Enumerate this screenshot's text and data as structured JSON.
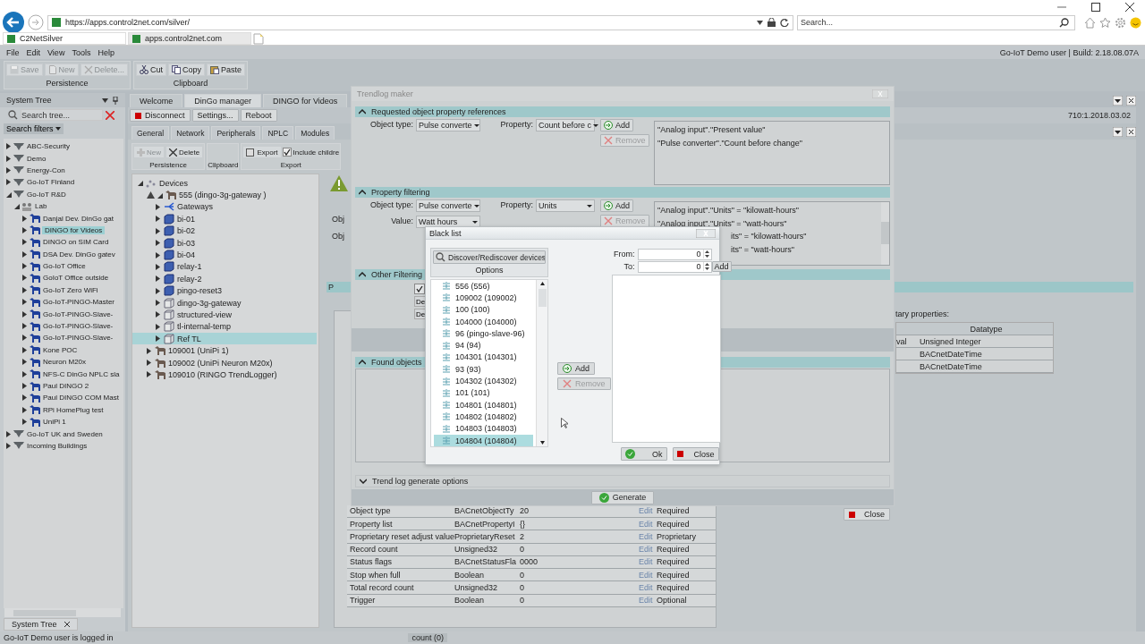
{
  "browser": {
    "address": "https://apps.control2net.com/silver/",
    "search": {
      "placeholder": "Search..."
    },
    "tabs": [
      {
        "label": "C2NetSilver",
        "selected": true
      },
      {
        "label": "apps.control2net.com",
        "selected": false
      }
    ]
  },
  "menu": [
    "File",
    "Edit",
    "View",
    "Tools",
    "Help"
  ],
  "user_info": "Go-IoT Demo user  | Build: 2.18.08.07A",
  "toolbar_groups": [
    {
      "label": "Persistence",
      "buttons": [
        {
          "label": "Save",
          "kind": "save",
          "disabled": true
        },
        {
          "label": "New",
          "kind": "new",
          "disabled": true
        },
        {
          "label": "Delete...",
          "kind": "delete",
          "disabled": true
        }
      ]
    },
    {
      "label": "Clipboard",
      "buttons": [
        {
          "label": "Cut",
          "kind": "cut",
          "disabled": false
        },
        {
          "label": "Copy",
          "kind": "copy",
          "disabled": false
        },
        {
          "label": "Paste",
          "kind": "paste",
          "disabled": false
        }
      ]
    }
  ],
  "system_tree": {
    "title": "System Tree",
    "search": {
      "placeholder": "Search tree..."
    },
    "filters": "Search filters",
    "bottom_tab": "System Tree",
    "items": [
      {
        "label": "ABC-Security",
        "kind": "site",
        "expanded": false,
        "selected": false
      },
      {
        "label": "Demo",
        "kind": "site",
        "expanded": false,
        "selected": false
      },
      {
        "label": "Energy-Con",
        "kind": "site",
        "expanded": false,
        "selected": false
      },
      {
        "label": "Go-IoT Finland",
        "kind": "site",
        "expanded": false,
        "selected": false
      },
      {
        "label": "Go-IoT R&D",
        "kind": "site",
        "expanded": true,
        "selected": false,
        "children": [
          {
            "label": "Lab",
            "kind": "group",
            "expanded": true,
            "selected": false,
            "children": [
              {
                "label": "Danjal Dev. DinGo gat",
                "kind": "device",
                "expanded": false,
                "selected": false
              },
              {
                "label": "DINGO for Videos",
                "kind": "device",
                "expanded": false,
                "selected": true
              },
              {
                "label": "DINGO on SIM Card",
                "kind": "device",
                "expanded": false,
                "selected": false
              },
              {
                "label": "DSA Dev. DinGo gatev",
                "kind": "device",
                "expanded": false,
                "selected": false
              },
              {
                "label": "Go-IoT Office",
                "kind": "device",
                "expanded": false,
                "selected": false
              },
              {
                "label": "GoIoT Office outside",
                "kind": "device",
                "expanded": false,
                "selected": false
              },
              {
                "label": "Go-IoT Zero WiFi",
                "kind": "device",
                "expanded": false,
                "selected": false
              },
              {
                "label": "Go-IoT-PINGO-Master",
                "kind": "device",
                "expanded": false,
                "selected": false
              },
              {
                "label": "Go-IoT-PINGO-Slave-",
                "kind": "device",
                "expanded": false,
                "selected": false
              },
              {
                "label": "Go-IoT-PINGO-Slave-",
                "kind": "device",
                "expanded": false,
                "selected": false
              },
              {
                "label": "Go-IoT-PINGO-Slave-",
                "kind": "device",
                "expanded": false,
                "selected": false
              },
              {
                "label": "Kone POC",
                "kind": "device",
                "expanded": false,
                "selected": false
              },
              {
                "label": "Neuron M20x",
                "kind": "device",
                "expanded": false,
                "selected": false
              },
              {
                "label": "NFS-C DinGo NPLC sla",
                "kind": "device",
                "expanded": false,
                "selected": false
              },
              {
                "label": "Paul DINGO 2",
                "kind": "device",
                "expanded": false,
                "selected": false
              },
              {
                "label": "Paul DINGO COM Mast",
                "kind": "device",
                "expanded": false,
                "selected": false
              },
              {
                "label": "RPi HomePlug test",
                "kind": "device",
                "expanded": false,
                "selected": false
              },
              {
                "label": "UniPi 1",
                "kind": "device",
                "expanded": false,
                "selected": false
              }
            ]
          }
        ]
      },
      {
        "label": "Go-IoT UK and Sweden",
        "kind": "site",
        "expanded": false,
        "selected": false
      },
      {
        "label": "Incoming Buildings",
        "kind": "site",
        "expanded": false,
        "selected": false
      }
    ]
  },
  "document_tabs": [
    {
      "label": "Welcome",
      "selected": false
    },
    {
      "label": "DinGo manager",
      "selected": true
    },
    {
      "label": "DINGO for Videos",
      "selected": false
    }
  ],
  "device_toolbar": [
    {
      "label": "Disconnect",
      "kind": "stop"
    },
    {
      "label": "Settings...",
      "kind": "plain"
    },
    {
      "label": "Reboot",
      "kind": "plain"
    }
  ],
  "version": "710:1.2018.03.02",
  "sub_tabs": [
    "General",
    "Network",
    "Peripherals",
    "NPLC",
    "Modules"
  ],
  "module_toolbar": {
    "groups": [
      "Persistence",
      "Clipboard",
      "Export"
    ],
    "new": {
      "label": "New",
      "disabled": true
    },
    "delete": {
      "label": "Delete",
      "disabled": false
    },
    "export": "Export",
    "include": {
      "label": "Include childre",
      "checked": true
    }
  },
  "devices": [
    {
      "label": "Devices",
      "kind": "devices",
      "expanded": true,
      "selected": false,
      "children": [
        {
          "label": "555 (dingo-3g-gateway )",
          "kind": "device",
          "warning": true,
          "expanded": true,
          "selected": false,
          "children": [
            {
              "label": "Gateways",
              "kind": "gateways",
              "expanded": false,
              "selected": false
            },
            {
              "label": "bi-01",
              "kind": "object",
              "expanded": false,
              "selected": false
            },
            {
              "label": "bi-02",
              "kind": "object",
              "expanded": false,
              "selected": false
            },
            {
              "label": "bi-03",
              "kind": "object",
              "expanded": false,
              "selected": false
            },
            {
              "label": "bi-04",
              "kind": "object",
              "expanded": false,
              "selected": false
            },
            {
              "label": "relay-1",
              "kind": "object",
              "expanded": false,
              "selected": false
            },
            {
              "label": "relay-2",
              "kind": "object",
              "expanded": false,
              "selected": false
            },
            {
              "label": "pingo-reset3",
              "kind": "object",
              "expanded": false,
              "selected": false
            },
            {
              "label": "dingo-3g-gateway",
              "kind": "outline",
              "expanded": false,
              "selected": false
            },
            {
              "label": "structured-view",
              "kind": "outline",
              "expanded": false,
              "selected": false
            },
            {
              "label": "tl-internal-temp",
              "kind": "outline",
              "expanded": false,
              "selected": false
            },
            {
              "label": "Ref TL",
              "kind": "outline",
              "expanded": false,
              "selected": true
            }
          ]
        },
        {
          "label": "109001 (UniPi 1)",
          "kind": "device",
          "expanded": false,
          "selected": false
        },
        {
          "label": "109002 (UniPi Neuron M20x)",
          "kind": "device",
          "expanded": false,
          "selected": false
        },
        {
          "label": "109010 (RINGO TrendLogger)",
          "kind": "device",
          "expanded": false,
          "selected": false
        }
      ]
    }
  ],
  "module_panel": {
    "obj_labels": [
      "Obj",
      "Obj"
    ],
    "section_fragment": "P",
    "properties_label": "tary properties:",
    "properties_table": {
      "columns": [
        "Datatype"
      ],
      "rows": [
        {
          "column_1": "val",
          "datatype": "Unsigned Integer"
        },
        {
          "datatype": "BACnetDateTime"
        },
        {
          "datatype": "BACnetDateTime"
        }
      ]
    },
    "object_table": [
      {
        "name": "Object type",
        "type": "BACnetObjectTy",
        "value": "20",
        "edit": "Edit",
        "status": "Required"
      },
      {
        "name": "Property list",
        "type": "BACnetPropertyI",
        "value": "{}",
        "edit": "Edit",
        "status": "Required"
      },
      {
        "name": "Proprietary reset adjust value",
        "type": "ProprietaryReset",
        "value": "2",
        "edit": "Edit",
        "status": "Proprietary"
      },
      {
        "name": "Record count",
        "type": "Unsigned32",
        "value": "0",
        "edit": "Edit",
        "status": "Required"
      },
      {
        "name": "Status flags",
        "type": "BACnetStatusFla",
        "value": "0000",
        "edit": "Edit",
        "status": "Required"
      },
      {
        "name": "Stop when full",
        "type": "Boolean",
        "value": "0",
        "edit": "Edit",
        "status": "Required"
      },
      {
        "name": "Total record count",
        "type": "Unsigned32",
        "value": "0",
        "edit": "Edit",
        "status": "Required"
      },
      {
        "name": "Trigger",
        "type": "Boolean",
        "value": "0",
        "edit": "Edit",
        "status": "Optional"
      }
    ]
  },
  "status_bar": {
    "message": "Go-IoT Demo user is logged in",
    "count": "count (0)"
  },
  "trendlog_dialog": {
    "title": "Trendlog maker",
    "requested": {
      "title": "Requested object property references",
      "expanded": true,
      "object_type": {
        "label": "Object type:",
        "value": "Pulse converte"
      },
      "property": {
        "label": "Property:",
        "value": "Count before c"
      },
      "add": "Add",
      "remove": {
        "label": "Remove",
        "disabled": true
      },
      "list": [
        {
          "text": "\"Analog input\".\"Present value\"",
          "cut": false
        },
        {
          "text": "\"Pulse converter\".\"Count before change\"",
          "cut": false
        }
      ]
    },
    "filtering": {
      "title": "Property filtering",
      "expanded": true,
      "object_type": {
        "label": "Object type:",
        "value": "Pulse converte"
      },
      "property": {
        "label": "Property:",
        "value": "Units"
      },
      "value": {
        "label": "Value:",
        "value": "Watt hours"
      },
      "add": "Add",
      "remove": {
        "label": "Remove",
        "disabled": true
      },
      "list": [
        {
          "text": "\"Analog input\".\"Units\" = \"kilowatt-hours\"",
          "cut": false
        },
        {
          "text": "\"Analog input\".\"Units\" = \"watt-hours\"",
          "cut": false
        },
        {
          "text": "its\" = \"kilowatt-hours\"",
          "cut": true
        },
        {
          "text": "its\" = \"watt-hours\"",
          "cut": true
        }
      ]
    },
    "other": {
      "title": "Other Filtering",
      "expanded": true,
      "checked": true,
      "buttons": [
        "De",
        "De"
      ]
    },
    "found": {
      "title": "Found objects",
      "expanded": true
    },
    "options": {
      "title": "Trend log generate options",
      "expanded": false
    },
    "generate": "Generate",
    "close": "Close"
  },
  "blacklist_dialog": {
    "title": "Black list",
    "discover": "Discover/Rediscover devices",
    "options": "Options",
    "devices": [
      {
        "label": "556 (556)",
        "selected": false
      },
      {
        "label": "109002 (109002)",
        "selected": false
      },
      {
        "label": "100 (100)",
        "selected": false
      },
      {
        "label": "104000 (104000)",
        "selected": false
      },
      {
        "label": "96 (pingo-slave-96)",
        "selected": false
      },
      {
        "label": "94 (94)",
        "selected": false
      },
      {
        "label": "104301 (104301)",
        "selected": false
      },
      {
        "label": "93 (93)",
        "selected": false
      },
      {
        "label": "104302 (104302)",
        "selected": false
      },
      {
        "label": "101 (101)",
        "selected": false
      },
      {
        "label": "104801 (104801)",
        "selected": false
      },
      {
        "label": "104802 (104802)",
        "selected": false
      },
      {
        "label": "104803 (104803)",
        "selected": false
      },
      {
        "label": "104804 (104804)",
        "selected": true
      }
    ],
    "add": "Add",
    "remove": {
      "label": "Remove",
      "disabled": true
    },
    "from": {
      "label": "From:",
      "value": "0"
    },
    "to": {
      "label": "To:",
      "value": "0"
    },
    "range_add": "Add",
    "ok": "Ok",
    "close": "Close"
  }
}
